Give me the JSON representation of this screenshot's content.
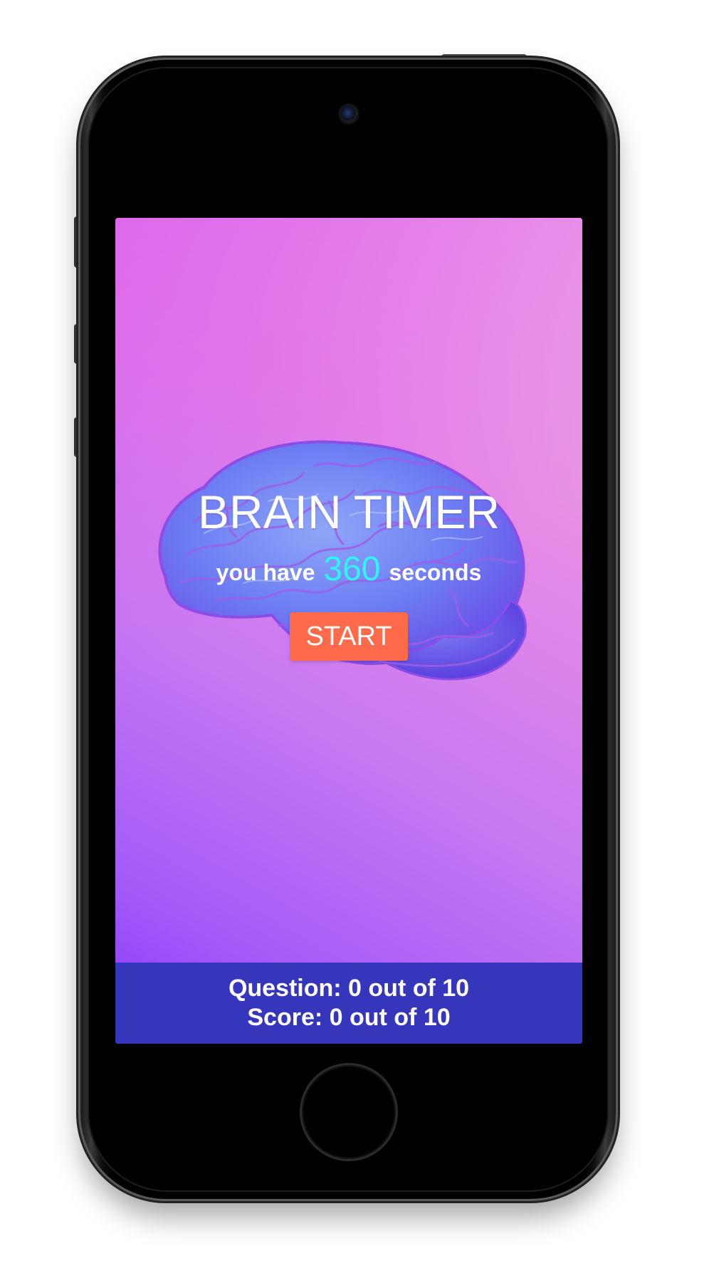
{
  "app": {
    "title": "BRAIN TIMER",
    "subtitle_prefix": "you have",
    "seconds": "360",
    "subtitle_suffix": "seconds",
    "start_label": "START"
  },
  "footer": {
    "question_text": "Question: 0 out of 10",
    "score_text": "Score: 0 out of 10"
  },
  "colors": {
    "accent_cyan": "#2ff5f0",
    "start_button": "#ff6b4a",
    "footer_bar": "#3636bd",
    "gradient_top": "#f3b3e6",
    "gradient_bottom": "#8b35fb"
  },
  "icons": {
    "hero_graphic": "brain-illustration"
  }
}
